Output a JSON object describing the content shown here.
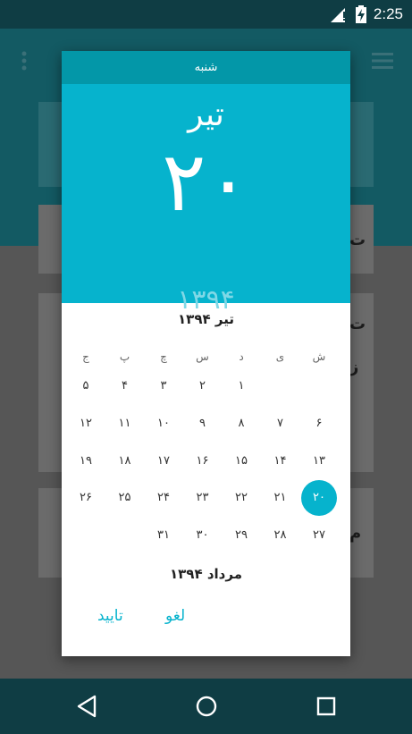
{
  "status_bar": {
    "time": "2:25"
  },
  "background": {
    "row1_char": "ت",
    "row2_char": "ت",
    "row3_char": "ز",
    "row4_char": "م"
  },
  "dialog": {
    "weekday": "شنبه",
    "header_month": "تیر",
    "header_day": "۲۰",
    "header_year": "۱۳۹۴",
    "month_title": "تیر ۱۳۹۴",
    "next_month_title": "مرداد ۱۳۹۴",
    "weekday_labels": [
      "ش",
      "ی",
      "د",
      "س",
      "چ",
      "پ",
      "ج"
    ],
    "weeks": [
      [
        "",
        "",
        "۱",
        "۲",
        "۳",
        "۴",
        "۵"
      ],
      [
        "۶",
        "۷",
        "۸",
        "۹",
        "۱۰",
        "۱۱",
        "۱۲"
      ],
      [
        "۱۳",
        "۱۴",
        "۱۵",
        "۱۶",
        "۱۷",
        "۱۸",
        "۱۹"
      ],
      [
        "۲۰",
        "۲۱",
        "۲۲",
        "۲۳",
        "۲۴",
        "۲۵",
        "۲۶"
      ],
      [
        "۲۷",
        "۲۸",
        "۲۹",
        "۳۰",
        "۳۱",
        "",
        ""
      ]
    ],
    "selected_day": "۲۰",
    "confirm_label": "تایید",
    "cancel_label": "لغو",
    "accent_color": "#06b3cd",
    "weekday_bar_color": "#0397a8"
  },
  "icons": {
    "status": [
      "signal-icon",
      "battery-charging-icon"
    ],
    "app": [
      "overflow-menu-icon",
      "hamburger-menu-icon"
    ],
    "nav": [
      "back-icon",
      "home-icon",
      "recents-icon"
    ]
  }
}
